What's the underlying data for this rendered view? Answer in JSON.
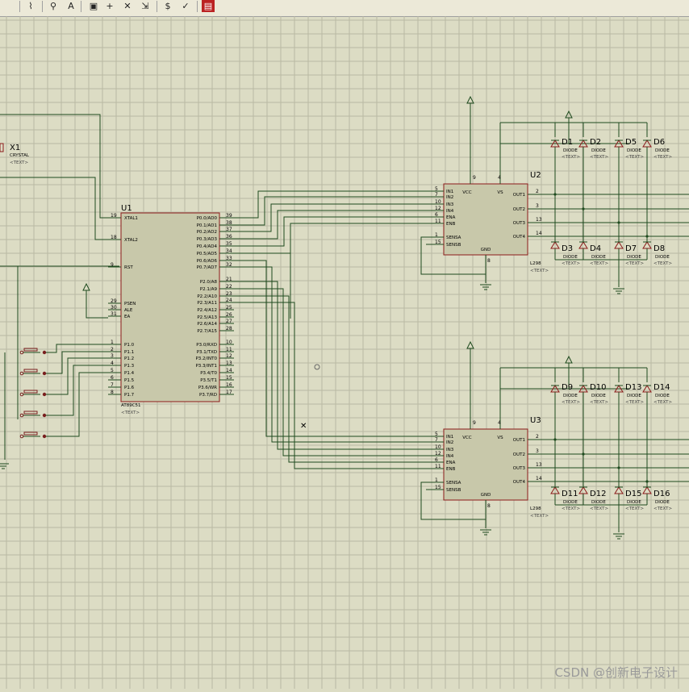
{
  "toolbar": {
    "buttons": [
      {
        "icon": "wire-autorouter-icon"
      },
      {
        "icon": "search-tag-icon"
      },
      {
        "icon": "property-assign-icon"
      },
      {
        "icon": "new-sheet-icon"
      },
      {
        "icon": "add-sheet-icon"
      },
      {
        "icon": "remove-sheet-icon"
      },
      {
        "icon": "goto-child-icon"
      },
      {
        "icon": "bill-of-materials-icon"
      },
      {
        "icon": "electrical-rule-check-icon"
      },
      {
        "icon": "netlist-to-ares-icon"
      }
    ]
  },
  "schematic": {
    "grid_color": "#b9b9a3",
    "wire_color": "#1e4a1e",
    "body_fill": "#c8c8aa",
    "body_stroke": "#8b1a1a",
    "text_placeholder": "<TEXT>",
    "crystal": {
      "ref": "X1",
      "value": "CRYSTAL"
    },
    "mcu": {
      "ref": "U1",
      "value": "AT89C51",
      "left_pins": [
        {
          "num": "19",
          "name": "XTAL1"
        },
        {
          "num": "18",
          "name": "XTAL2"
        },
        {
          "num": "9",
          "name": "RST"
        },
        {
          "num": "29",
          "name": "PSEN"
        },
        {
          "num": "30",
          "name": "ALE"
        },
        {
          "num": "31",
          "name": "EA"
        },
        {
          "num": "1",
          "name": "P1.0"
        },
        {
          "num": "2",
          "name": "P1.1"
        },
        {
          "num": "3",
          "name": "P1.2"
        },
        {
          "num": "4",
          "name": "P1.3"
        },
        {
          "num": "5",
          "name": "P1.4"
        },
        {
          "num": "6",
          "name": "P1.5"
        },
        {
          "num": "7",
          "name": "P1.6"
        },
        {
          "num": "8",
          "name": "P1.7"
        }
      ],
      "right_pins": [
        {
          "num": "39",
          "name": "P0.0/AD0"
        },
        {
          "num": "38",
          "name": "P0.1/AD1"
        },
        {
          "num": "37",
          "name": "P0.2/AD2"
        },
        {
          "num": "36",
          "name": "P0.3/AD3"
        },
        {
          "num": "35",
          "name": "P0.4/AD4"
        },
        {
          "num": "34",
          "name": "P0.5/AD5"
        },
        {
          "num": "33",
          "name": "P0.6/AD6"
        },
        {
          "num": "32",
          "name": "P0.7/AD7"
        },
        {
          "num": "21",
          "name": "P2.0/A8"
        },
        {
          "num": "22",
          "name": "P2.1/A9"
        },
        {
          "num": "23",
          "name": "P2.2/A10"
        },
        {
          "num": "24",
          "name": "P2.3/A11"
        },
        {
          "num": "25",
          "name": "P2.4/A12"
        },
        {
          "num": "26",
          "name": "P2.5/A13"
        },
        {
          "num": "27",
          "name": "P2.6/A14"
        },
        {
          "num": "28",
          "name": "P2.7/A15"
        },
        {
          "num": "10",
          "name": "P3.0/RXD"
        },
        {
          "num": "11",
          "name": "P3.1/TXD"
        },
        {
          "num": "12",
          "name": "P3.2/INT0"
        },
        {
          "num": "13",
          "name": "P3.3/INT1"
        },
        {
          "num": "14",
          "name": "P3.4/T0"
        },
        {
          "num": "15",
          "name": "P3.5/T1"
        },
        {
          "num": "16",
          "name": "P3.6/WR"
        },
        {
          "num": "17",
          "name": "P3.7/RD"
        }
      ]
    },
    "drivers": [
      {
        "ref": "U2",
        "value": "L298",
        "left_pins": [
          {
            "num": "5",
            "name": "IN1"
          },
          {
            "num": "7",
            "name": "IN2"
          },
          {
            "num": "10",
            "name": "IN3"
          },
          {
            "num": "12",
            "name": "IN4"
          },
          {
            "num": "6",
            "name": "ENA"
          },
          {
            "num": "11",
            "name": "ENB"
          },
          {
            "num": "1",
            "name": "SENSA"
          },
          {
            "num": "15",
            "name": "SENSB"
          }
        ],
        "top_pins": [
          {
            "num": "9",
            "name": "VCC"
          },
          {
            "num": "4",
            "name": "VS"
          }
        ],
        "right_pins": [
          {
            "num": "2",
            "name": "OUT1"
          },
          {
            "num": "3",
            "name": "OUT2"
          },
          {
            "num": "13",
            "name": "OUT3"
          },
          {
            "num": "14",
            "name": "OUT4"
          }
        ],
        "bottom_pin": {
          "num": "8",
          "name": "GND"
        },
        "diodes_top": [
          "D1",
          "D2",
          "D5",
          "D6"
        ],
        "diodes_bottom": [
          "D3",
          "D4",
          "D7",
          "D8"
        ]
      },
      {
        "ref": "U3",
        "value": "L298",
        "left_pins": [
          {
            "num": "5",
            "name": "IN1"
          },
          {
            "num": "7",
            "name": "IN2"
          },
          {
            "num": "10",
            "name": "IN3"
          },
          {
            "num": "12",
            "name": "IN4"
          },
          {
            "num": "6",
            "name": "ENA"
          },
          {
            "num": "11",
            "name": "ENB"
          },
          {
            "num": "1",
            "name": "SENSA"
          },
          {
            "num": "15",
            "name": "SENSB"
          }
        ],
        "top_pins": [
          {
            "num": "9",
            "name": "VCC"
          },
          {
            "num": "4",
            "name": "VS"
          }
        ],
        "right_pins": [
          {
            "num": "2",
            "name": "OUT1"
          },
          {
            "num": "3",
            "name": "OUT2"
          },
          {
            "num": "13",
            "name": "OUT3"
          },
          {
            "num": "14",
            "name": "OUT4"
          }
        ],
        "bottom_pin": {
          "num": "8",
          "name": "GND"
        },
        "diodes_top": [
          "D9",
          "D10",
          "D13",
          "D14"
        ],
        "diodes_bottom": [
          "D11",
          "D12",
          "D15",
          "D16"
        ]
      }
    ],
    "diode_value": "DIODE"
  },
  "watermark": "CSDN @创新电子设计"
}
